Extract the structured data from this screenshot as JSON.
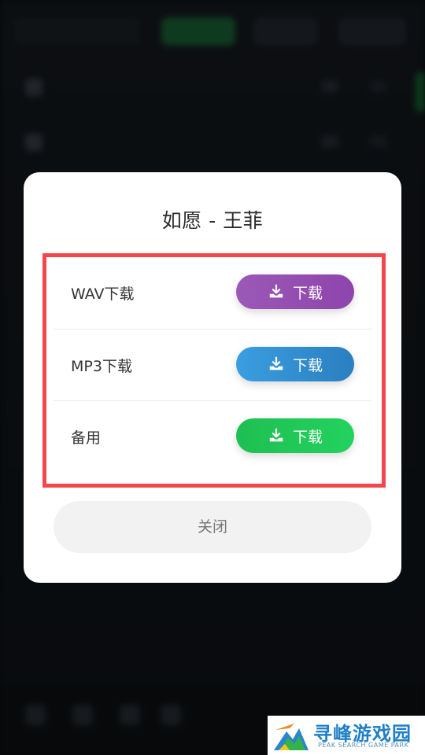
{
  "dialog": {
    "title": "如愿 - 王菲",
    "options": [
      {
        "label": "WAV下载",
        "button": "下载",
        "color": "#8e44ad"
      },
      {
        "label": "MP3下载",
        "button": "下载",
        "color": "#2a7fc0"
      },
      {
        "label": "备用",
        "button": "下载",
        "color": "#22c55e"
      }
    ],
    "close_label": "关闭",
    "highlight_color": "#f4474c"
  },
  "watermark": {
    "name": "寻峰游戏园",
    "subtitle": "PEAK SEARCH GAME PARK"
  }
}
